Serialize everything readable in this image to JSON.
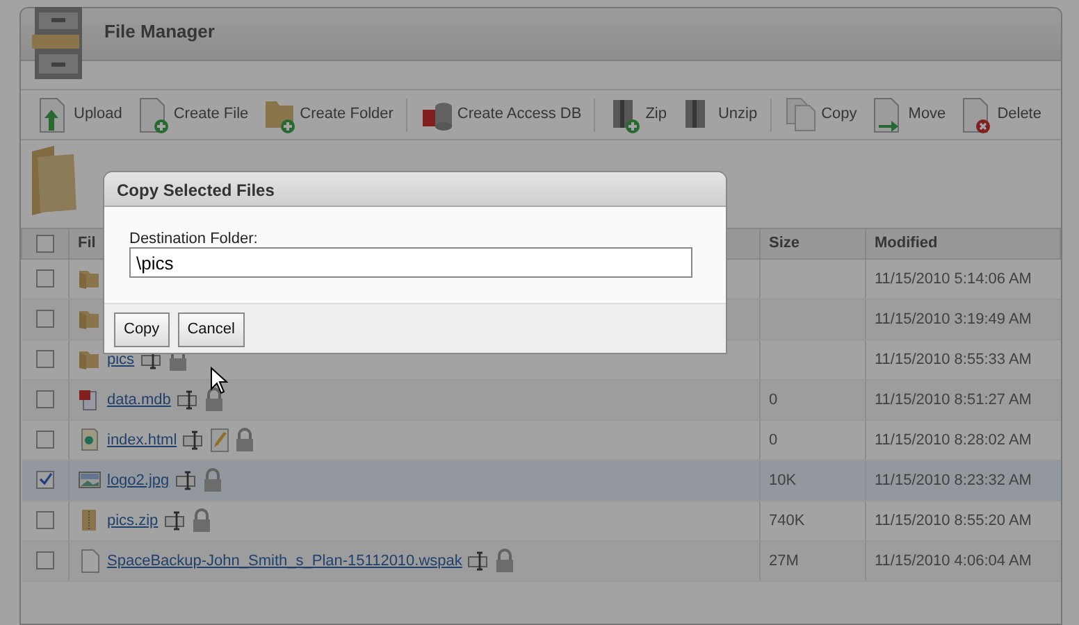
{
  "window": {
    "title": "File Manager"
  },
  "toolbar": [
    [
      {
        "kind": "upload",
        "label": "Upload"
      },
      {
        "kind": "new-file",
        "label": "Create File"
      },
      {
        "kind": "new-folder",
        "label": "Create Folder"
      }
    ],
    [
      {
        "kind": "database",
        "label": "Create Access DB"
      }
    ],
    [
      {
        "kind": "zip",
        "label": "Zip"
      },
      {
        "kind": "unzip",
        "label": "Unzip"
      }
    ],
    [
      {
        "kind": "copy",
        "label": "Copy"
      },
      {
        "kind": "move",
        "label": "Move"
      },
      {
        "kind": "delete",
        "label": "Delete"
      }
    ]
  ],
  "table": {
    "columns": [
      "Fil",
      "Size",
      "Modified"
    ],
    "header_checked": false,
    "rows": [
      {
        "kind": "folder",
        "name": "",
        "size": "",
        "modified": "11/15/2010 5:14:06 AM",
        "selected": false,
        "editable": false
      },
      {
        "kind": "folder",
        "name": "",
        "size": "",
        "modified": "11/15/2010 3:19:49 AM",
        "selected": false,
        "editable": false
      },
      {
        "kind": "folder",
        "name": "pics",
        "size": "",
        "modified": "11/15/2010 8:55:33 AM",
        "selected": false,
        "editable": false
      },
      {
        "kind": "database",
        "name": "data.mdb",
        "size": "0",
        "modified": "11/15/2010 8:51:27 AM",
        "selected": false,
        "editable": false
      },
      {
        "kind": "web",
        "name": "index.html",
        "size": "0",
        "modified": "11/15/2010 8:28:02 AM",
        "selected": false,
        "editable": true
      },
      {
        "kind": "image",
        "name": "logo2.jpg",
        "size": "10K",
        "modified": "11/15/2010 8:23:32 AM",
        "selected": true,
        "editable": false
      },
      {
        "kind": "zip",
        "name": "pics.zip",
        "size": "740K",
        "modified": "11/15/2010 8:55:20 AM",
        "selected": false,
        "editable": false
      },
      {
        "kind": "file",
        "name": "SpaceBackup-John_Smith_s_Plan-15112010.wspak",
        "size": "27M",
        "modified": "11/15/2010 4:06:04 AM",
        "selected": false,
        "editable": false
      }
    ]
  },
  "dialog": {
    "title": "Copy Selected Files",
    "field_label": "Destination Folder:",
    "value": "\\pics",
    "buttons": [
      "Copy",
      "Cancel"
    ]
  }
}
